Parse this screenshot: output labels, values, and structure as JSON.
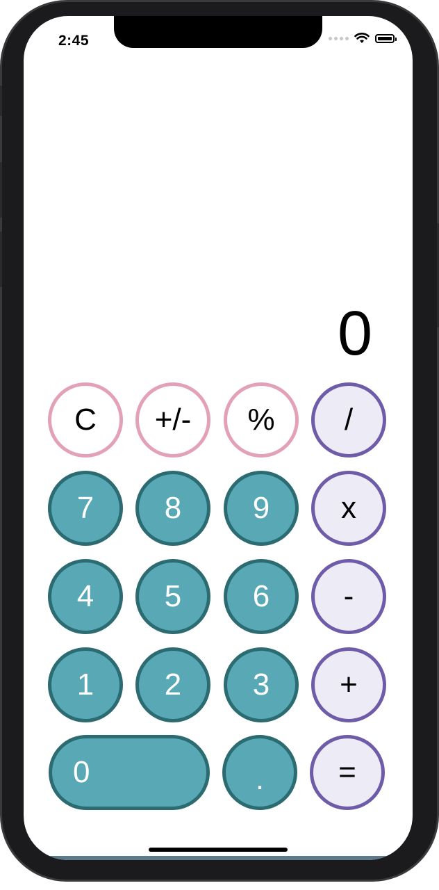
{
  "status_bar": {
    "time": "2:45"
  },
  "display": {
    "value": "0"
  },
  "keypad": {
    "row1": [
      "C",
      "+/-",
      "%",
      "/"
    ],
    "row2": [
      "7",
      "8",
      "9",
      "x"
    ],
    "row3": [
      "4",
      "5",
      "6",
      "-"
    ],
    "row4": [
      "1",
      "2",
      "3",
      "+"
    ],
    "row5": [
      "0",
      ".",
      "="
    ]
  },
  "colors": {
    "function_border": "#e3a1b7",
    "operator_border": "#6f5ca8",
    "operator_fill": "#ecebf6",
    "number_fill": "#58a8b5",
    "number_border": "#2b6b71"
  }
}
